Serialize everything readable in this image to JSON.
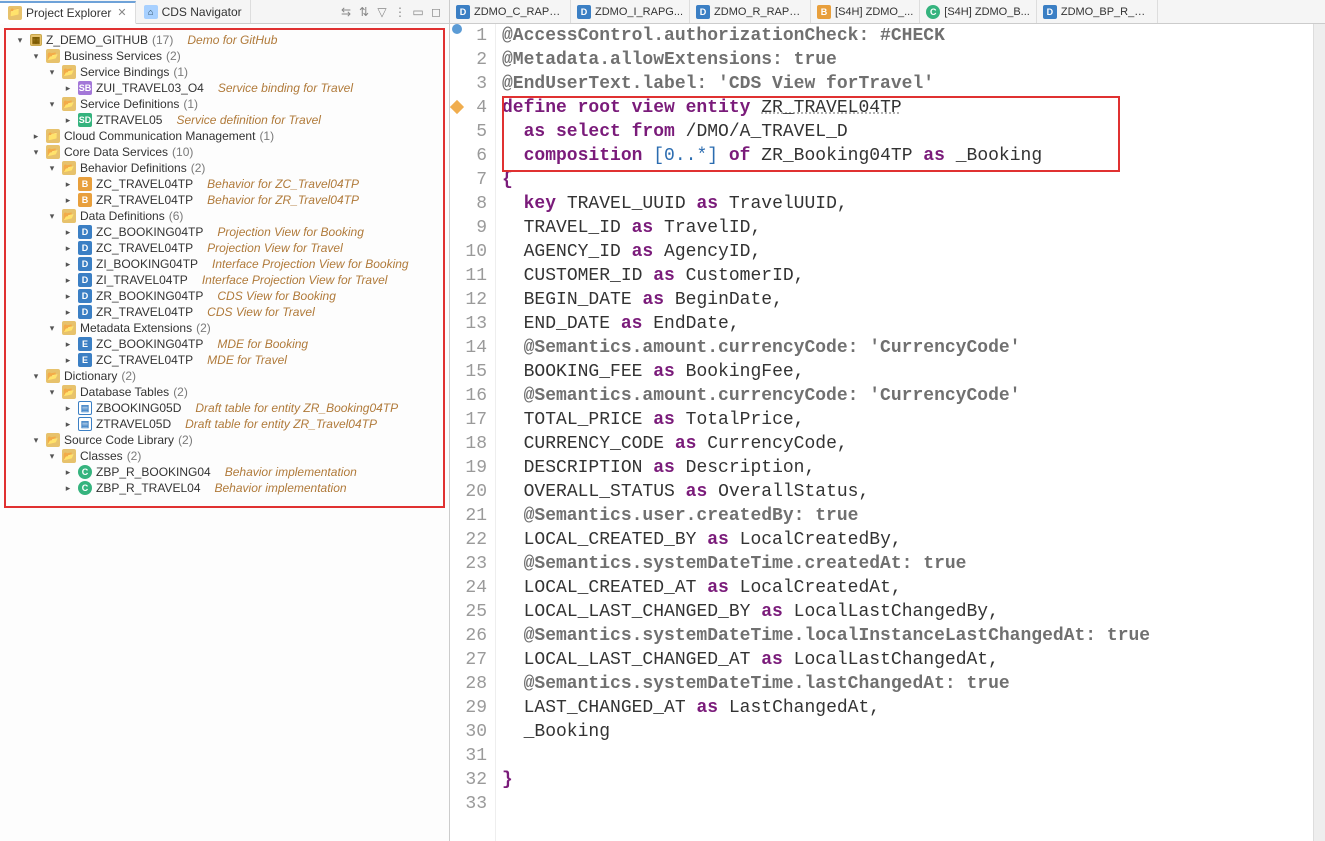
{
  "views": {
    "project_explorer": "Project Explorer",
    "cds_navigator": "CDS Navigator"
  },
  "tree": {
    "root": {
      "name": "Z_DEMO_GITHUB",
      "count": "(17)",
      "desc": "Demo for GitHub"
    },
    "business_services": {
      "name": "Business Services",
      "count": "(2)"
    },
    "service_bindings": {
      "name": "Service Bindings",
      "count": "(1)"
    },
    "sb_item": {
      "name": "ZUI_TRAVEL03_O4",
      "desc": "Service binding for Travel"
    },
    "service_definitions": {
      "name": "Service Definitions",
      "count": "(1)"
    },
    "sd_item": {
      "name": "ZTRAVEL05",
      "desc": "Service definition for Travel"
    },
    "cloud_comm": {
      "name": "Cloud Communication Management",
      "count": "(1)"
    },
    "core_data_services": {
      "name": "Core Data Services",
      "count": "(10)"
    },
    "behavior_defs": {
      "name": "Behavior Definitions",
      "count": "(2)"
    },
    "bd1": {
      "name": "ZC_TRAVEL04TP",
      "desc": "Behavior for ZC_Travel04TP"
    },
    "bd2": {
      "name": "ZR_TRAVEL04TP",
      "desc": "Behavior for ZR_Travel04TP"
    },
    "data_defs": {
      "name": "Data Definitions",
      "count": "(6)"
    },
    "dd1": {
      "name": "ZC_BOOKING04TP",
      "desc": "Projection View for Booking"
    },
    "dd2": {
      "name": "ZC_TRAVEL04TP",
      "desc": "Projection View for Travel"
    },
    "dd3": {
      "name": "ZI_BOOKING04TP",
      "desc": "Interface Projection View for Booking"
    },
    "dd4": {
      "name": "ZI_TRAVEL04TP",
      "desc": "Interface Projection View for Travel"
    },
    "dd5": {
      "name": "ZR_BOOKING04TP",
      "desc": "CDS View for Booking"
    },
    "dd6": {
      "name": "ZR_TRAVEL04TP",
      "desc": "CDS View for Travel"
    },
    "meta_ext": {
      "name": "Metadata Extensions",
      "count": "(2)"
    },
    "me1": {
      "name": "ZC_BOOKING04TP",
      "desc": "MDE for Booking"
    },
    "me2": {
      "name": "ZC_TRAVEL04TP",
      "desc": "MDE for Travel"
    },
    "dictionary": {
      "name": "Dictionary",
      "count": "(2)"
    },
    "db_tables": {
      "name": "Database Tables",
      "count": "(2)"
    },
    "tbl1": {
      "name": "ZBOOKING05D",
      "desc": "Draft table for entity ZR_Booking04TP"
    },
    "tbl2": {
      "name": "ZTRAVEL05D",
      "desc": "Draft table for entity ZR_Travel04TP"
    },
    "source_code": {
      "name": "Source Code Library",
      "count": "(2)"
    },
    "classes": {
      "name": "Classes",
      "count": "(2)"
    },
    "cls1": {
      "name": "ZBP_R_BOOKING04",
      "desc": "Behavior implementation"
    },
    "cls2": {
      "name": "ZBP_R_TRAVEL04",
      "desc": "Behavior implementation"
    }
  },
  "editor_tabs": [
    {
      "label": "ZDMO_C_RAPG..."
    },
    {
      "label": "ZDMO_I_RAPG..."
    },
    {
      "label": "ZDMO_R_RAPG..."
    },
    {
      "label": "[S4H] ZDMO_..."
    },
    {
      "label": "[S4H] ZDMO_B..."
    },
    {
      "label": "ZDMO_BP_R_RA..."
    }
  ],
  "editor_tab_icons": [
    "dd",
    "dd",
    "dd",
    "bd",
    "cls",
    "dd"
  ],
  "code": {
    "l1": "@AccessControl.authorizationCheck: #CHECK",
    "l2": "@Metadata.allowExtensions: true",
    "l3": "@EndUserText.label: 'CDS View forTravel'",
    "l4a": "define root view entity ",
    "l4b": "ZR_TRAVEL04TP",
    "l5a": "  as select from ",
    "l5b": "/DMO/A_TRAVEL_D",
    "l6a": "  composition ",
    "l6b": "[0..*]",
    "l6c": " of ",
    "l6d": "ZR_Booking04TP",
    "l6e": " as ",
    "l6f": "_Booking",
    "l7": "{",
    "l8a": "  key ",
    "l8b": "TRAVEL_UUID",
    "l8c": " as ",
    "l8d": "TravelUUID,",
    "l9a": "  ",
    "l9b": "TRAVEL_ID",
    "l9c": " as ",
    "l9d": "TravelID,",
    "l10a": "  ",
    "l10b": "AGENCY_ID",
    "l10c": " as ",
    "l10d": "AgencyID,",
    "l11a": "  ",
    "l11b": "CUSTOMER_ID",
    "l11c": " as ",
    "l11d": "CustomerID,",
    "l12a": "  ",
    "l12b": "BEGIN_DATE",
    "l12c": " as ",
    "l12d": "BeginDate,",
    "l13a": "  ",
    "l13b": "END_DATE",
    "l13c": " as ",
    "l13d": "EndDate,",
    "l14": "  @Semantics.amount.currencyCode: 'CurrencyCode'",
    "l15a": "  ",
    "l15b": "BOOKING_FEE",
    "l15c": " as ",
    "l15d": "BookingFee,",
    "l16": "  @Semantics.amount.currencyCode: 'CurrencyCode'",
    "l17a": "  ",
    "l17b": "TOTAL_PRICE",
    "l17c": " as ",
    "l17d": "TotalPrice,",
    "l18a": "  ",
    "l18b": "CURRENCY_CODE",
    "l18c": " as ",
    "l18d": "CurrencyCode,",
    "l19a": "  ",
    "l19b": "DESCRIPTION",
    "l19c": " as ",
    "l19d": "Description,",
    "l20a": "  ",
    "l20b": "OVERALL_STATUS",
    "l20c": " as ",
    "l20d": "OverallStatus,",
    "l21": "  @Semantics.user.createdBy: true",
    "l22a": "  ",
    "l22b": "LOCAL_CREATED_BY",
    "l22c": " as ",
    "l22d": "LocalCreatedBy,",
    "l23": "  @Semantics.systemDateTime.createdAt: true",
    "l24a": "  ",
    "l24b": "LOCAL_CREATED_AT",
    "l24c": " as ",
    "l24d": "LocalCreatedAt,",
    "l25a": "  ",
    "l25b": "LOCAL_LAST_CHANGED_BY",
    "l25c": " as ",
    "l25d": "LocalLastChangedBy,",
    "l26": "  @Semantics.systemDateTime.localInstanceLastChangedAt: true",
    "l27a": "  ",
    "l27b": "LOCAL_LAST_CHANGED_AT",
    "l27c": " as ",
    "l27d": "LocalLastChangedAt,",
    "l28": "  @Semantics.systemDateTime.lastChangedAt: true",
    "l29a": "  ",
    "l29b": "LAST_CHANGED_AT",
    "l29c": " as ",
    "l29d": "LastChangedAt,",
    "l30": "  _Booking",
    "l31": "",
    "l32": "}",
    "l33": ""
  }
}
